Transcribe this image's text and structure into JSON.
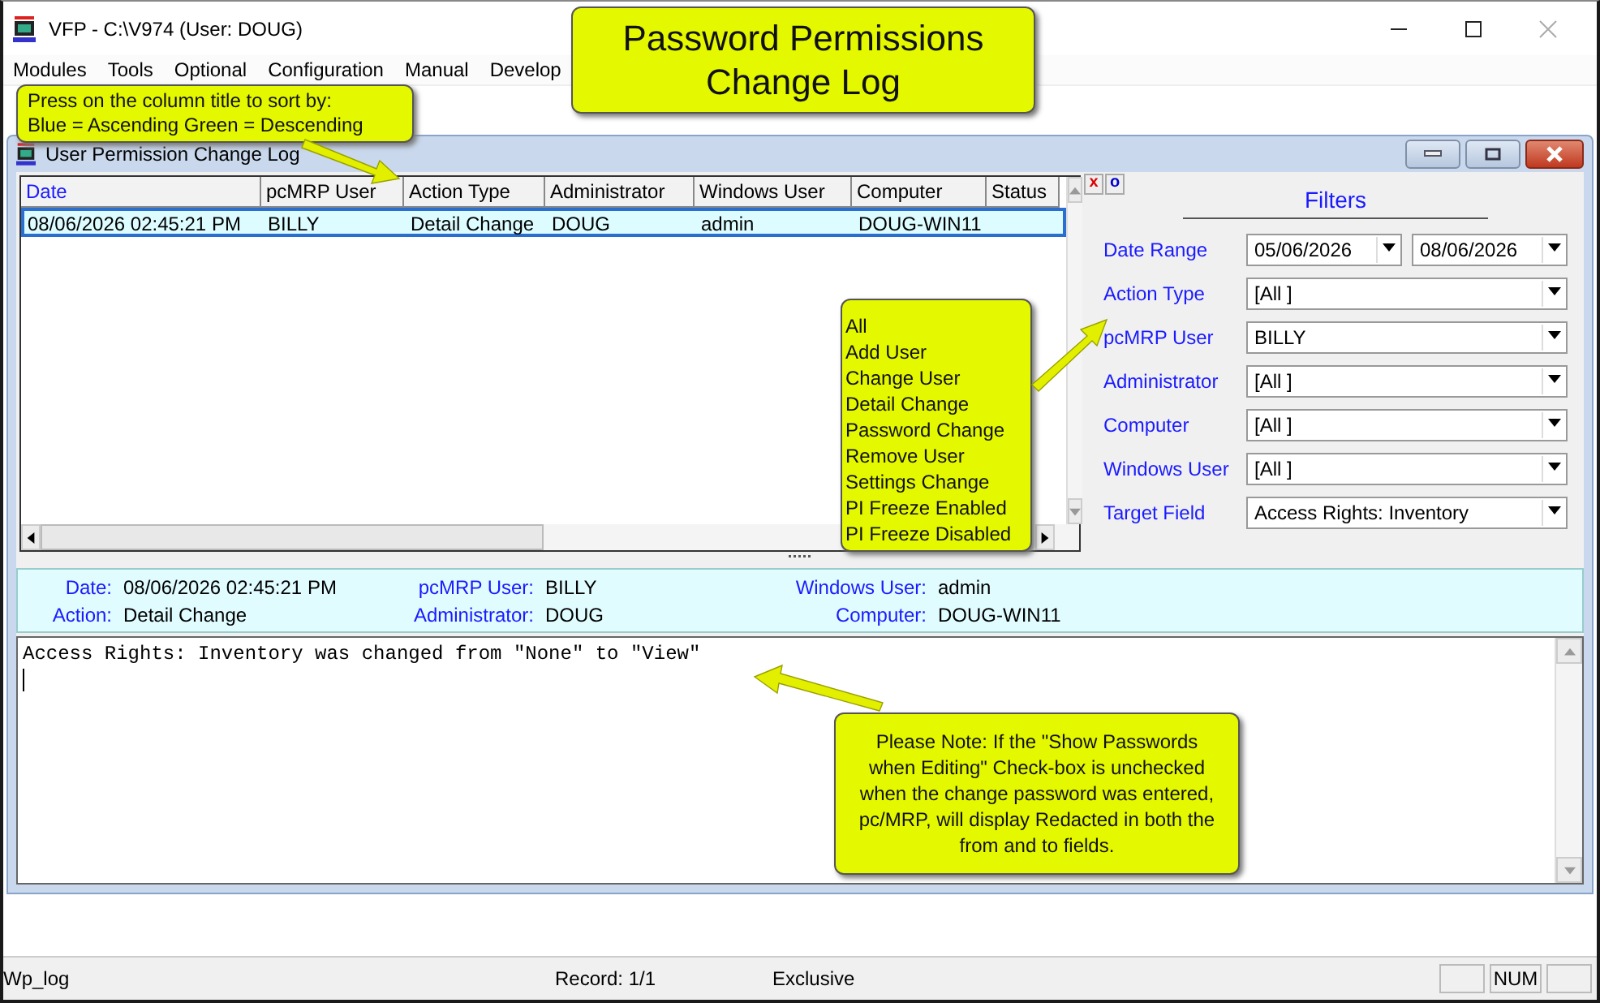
{
  "window": {
    "title": "VFP - C:\\V974  (User: DOUG)"
  },
  "menu": [
    "Modules",
    "Tools",
    "Optional",
    "Configuration",
    "Manual",
    "Develop"
  ],
  "child_window": {
    "title": "User Permission Change Log"
  },
  "table": {
    "columns": [
      {
        "label": "Date",
        "sort_ascending": true
      },
      {
        "label": "pcMRP User",
        "sort_ascending": false
      },
      {
        "label": "Action Type",
        "sort_ascending": false
      },
      {
        "label": "Administrator",
        "sort_ascending": false
      },
      {
        "label": "Windows User",
        "sort_ascending": false
      },
      {
        "label": "Computer",
        "sort_ascending": false
      },
      {
        "label": "Status",
        "sort_ascending": false
      }
    ],
    "rows": [
      {
        "selected": true,
        "cells": [
          "08/06/2026 02:45:21 PM",
          "BILLY",
          "Detail Change",
          "DOUG",
          "admin",
          "DOUG-WIN11",
          ""
        ]
      }
    ]
  },
  "filter_buttons": [
    "x",
    "o"
  ],
  "filters": {
    "title": "Filters",
    "fields": [
      {
        "label": "Date Range",
        "values": [
          "05/06/2026",
          "08/06/2026"
        ]
      },
      {
        "label": "Action Type",
        "values": [
          "[All ]"
        ]
      },
      {
        "label": "pcMRP User",
        "values": [
          "BILLY"
        ]
      },
      {
        "label": "Administrator",
        "values": [
          "[All ]"
        ]
      },
      {
        "label": "Computer",
        "values": [
          "[All ]"
        ]
      },
      {
        "label": "Windows User",
        "values": [
          "[All ]"
        ]
      },
      {
        "label": "Target Field",
        "values": [
          "Access Rights: Inventory"
        ]
      }
    ]
  },
  "detail": [
    {
      "label": "Date:",
      "value": "08/06/2026 02:45:21 PM"
    },
    {
      "label": "pcMRP User:",
      "value": "BILLY"
    },
    {
      "label": "Windows User:",
      "value": "admin"
    },
    {
      "label": "Action:",
      "value": "Detail Change"
    },
    {
      "label": "Administrator:",
      "value": "DOUG"
    },
    {
      "label": "Computer:",
      "value": "DOUG-WIN11"
    }
  ],
  "memo": "Access Rights: Inventory was changed from \"None\" to \"View\"",
  "status_bar": {
    "table": "Wp_log",
    "record": "Record: 1/1",
    "mode": "Exclusive",
    "num": "NUM"
  },
  "callouts": {
    "title": [
      "Password Permissions",
      "Change Log"
    ],
    "sort_hint": [
      "Press on the column  title to sort by:",
      "Blue = Ascending Green = Descending"
    ],
    "action_types": [
      "All",
      "Add User",
      "Change User",
      "Detail Change",
      "Password Change",
      "Remove User",
      "Settings Change",
      "PI Freeze Enabled",
      "PI Freeze Disabled"
    ],
    "note": "Please Note:  If the \"Show Passwords when Editing\" Check-box is unchecked when the change password was entered, pc/MRP, will display Redacted in both the from and to fields."
  }
}
